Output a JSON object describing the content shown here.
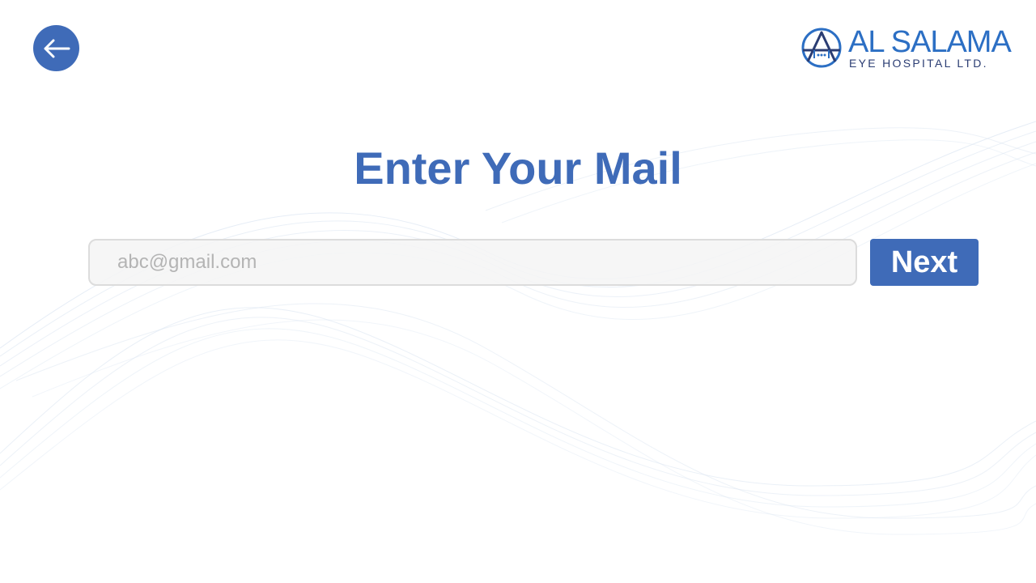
{
  "theme": {
    "accent": "#3f6bb8",
    "logo_blue": "#2c6fc4",
    "logo_navy": "#2b3d73"
  },
  "header": {
    "back_icon": "arrow-left-icon",
    "logo": {
      "emblem_icon": "al-salama-emblem-icon",
      "name": "AL SALAMA",
      "subtitle": "EYE HOSPITAL LTD."
    }
  },
  "main": {
    "title": "Enter Your Mail",
    "email": {
      "value": "",
      "placeholder": "abc@gmail.com"
    },
    "next_label": "Next"
  }
}
